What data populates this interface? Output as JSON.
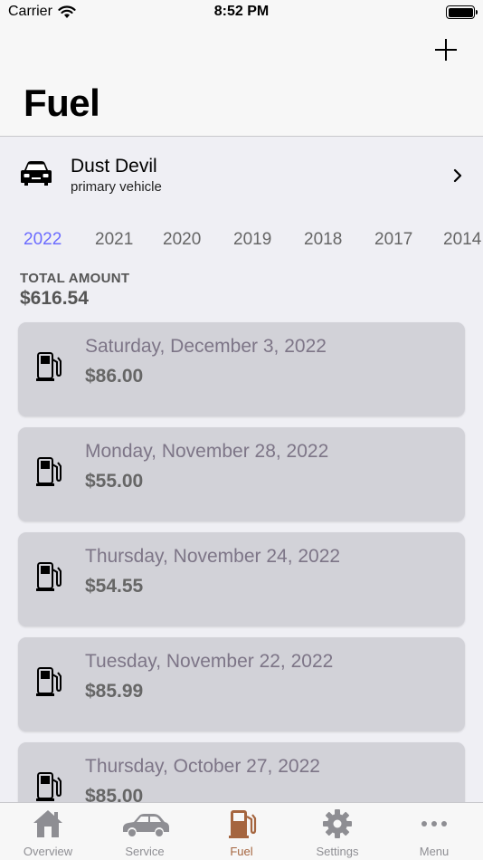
{
  "status_bar": {
    "carrier": "Carrier",
    "time": "8:52 PM"
  },
  "header": {
    "title": "Fuel",
    "add_icon": "plus-icon"
  },
  "vehicle": {
    "name": "Dust Devil",
    "subtitle": "primary vehicle",
    "icon": "car-icon"
  },
  "years": [
    "2022",
    "2021",
    "2020",
    "2019",
    "2018",
    "2017",
    "2014"
  ],
  "selected_year": "2022",
  "total": {
    "label": "TOTAL AMOUNT",
    "value": "$616.54"
  },
  "entries": [
    {
      "date": "Saturday, December 3, 2022",
      "amount": "$86.00"
    },
    {
      "date": "Monday, November 28, 2022",
      "amount": "$55.00"
    },
    {
      "date": "Thursday, November 24, 2022",
      "amount": "$54.55"
    },
    {
      "date": "Tuesday, November 22, 2022",
      "amount": "$85.99"
    },
    {
      "date": "Thursday, October 27, 2022",
      "amount": "$85.00"
    }
  ],
  "tabs": [
    {
      "label": "Overview",
      "icon": "house-icon"
    },
    {
      "label": "Service",
      "icon": "car-icon"
    },
    {
      "label": "Fuel",
      "icon": "fuel-pump-icon"
    },
    {
      "label": "Settings",
      "icon": "gear-icon"
    },
    {
      "label": "Menu",
      "icon": "ellipsis-icon"
    }
  ],
  "active_tab": "Fuel",
  "colors": {
    "accent_year": "#6b6bff",
    "active_tab": "#a5653f",
    "card_bg": "#d2d2d8",
    "inactive_tab": "#8e8e93"
  }
}
